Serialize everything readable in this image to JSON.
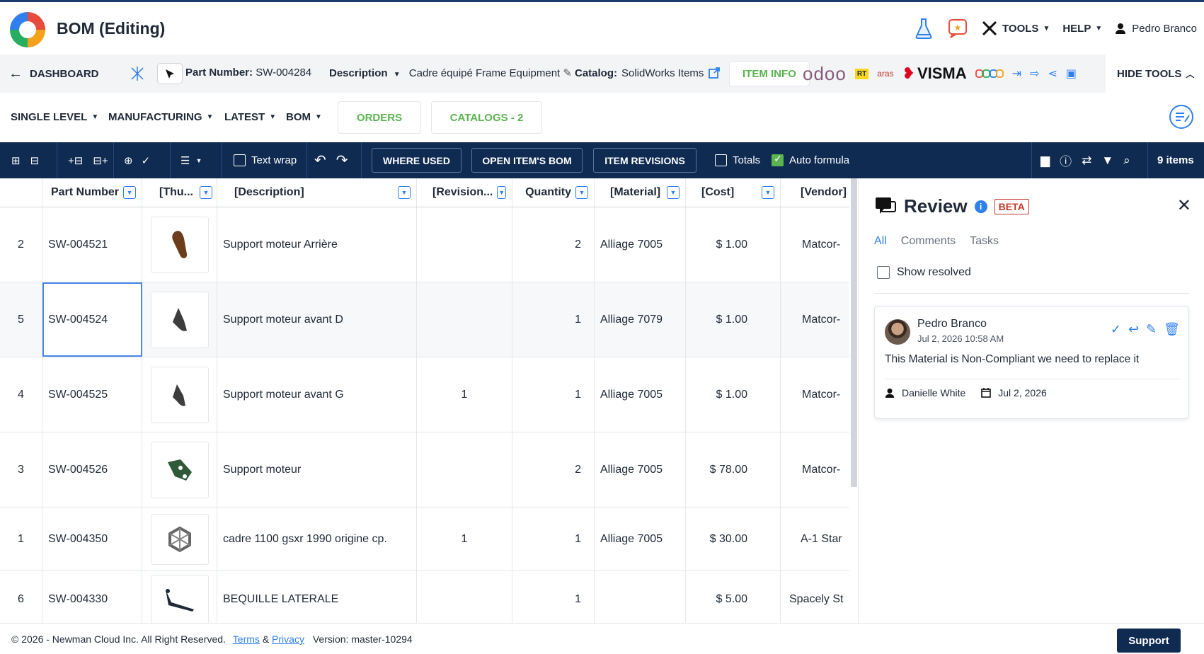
{
  "header": {
    "title": "BOM (Editing)",
    "tools_label": "TOOLS",
    "help_label": "HELP",
    "user_name": "Pedro Branco"
  },
  "partbar": {
    "dashboard_label": "DASHBOARD",
    "part_number_label": "Part Number:",
    "part_number": "SW-004284",
    "description_label": "Description",
    "description_value": "Cadre équipé Frame Equipment",
    "catalog_label": "Catalog:",
    "catalog_value": "SolidWorks Items",
    "item_info_label": "ITEM INFO",
    "brand_odoo": "odoo",
    "brand_rt": "RT",
    "brand_aras": "aras",
    "brand_visma": "VISMA",
    "hide_tools_label": "HIDE TOOLS"
  },
  "filters": {
    "level": "SINGLE LEVEL",
    "type": "MANUFACTURING",
    "revision": "LATEST",
    "view": "BOM",
    "orders_label": "ORDERS",
    "catalogs_label": "CATALOGS - 2"
  },
  "toolbar": {
    "text_wrap_label": "Text wrap",
    "where_used_label": "WHERE USED",
    "open_bom_label": "OPEN ITEM'S BOM",
    "item_revisions_label": "ITEM REVISIONS",
    "totals_label": "Totals",
    "auto_formula_label": "Auto formula",
    "items_count": "9 items"
  },
  "grid": {
    "columns": [
      "Part Number",
      "[Thu...",
      "[Description]",
      "[Revision...",
      "Quantity",
      "[Material]",
      "[Cost]",
      "[Vendor]"
    ],
    "rows": [
      {
        "idx": "2",
        "part": "SW-004521",
        "desc": "Support moteur Arrière",
        "rev": "",
        "qty": "2",
        "material": "Alliage 7005",
        "cost": "$ 1.00",
        "vendor": "Matcor-"
      },
      {
        "idx": "5",
        "part": "SW-004524",
        "desc": "Support moteur avant D",
        "rev": "",
        "qty": "1",
        "material": "Alliage 7079",
        "cost": "$ 1.00",
        "vendor": "Matcor-"
      },
      {
        "idx": "4",
        "part": "SW-004525",
        "desc": "Support moteur avant G",
        "rev": "1",
        "qty": "1",
        "material": "Alliage 7005",
        "cost": "$ 1.00",
        "vendor": "Matcor-"
      },
      {
        "idx": "3",
        "part": "SW-004526",
        "desc": "Support moteur",
        "rev": "",
        "qty": "2",
        "material": "Alliage 7005",
        "cost": "$ 78.00",
        "vendor": "Matcor-"
      },
      {
        "idx": "1",
        "part": "SW-004350",
        "desc": "cadre 1100 gsxr 1990 origine cp.",
        "rev": "1",
        "qty": "1",
        "material": "Alliage 7005",
        "cost": "$ 30.00",
        "vendor": "A-1 Star"
      },
      {
        "idx": "6",
        "part": "SW-004330",
        "desc": "BEQUILLE LATERALE",
        "rev": "",
        "qty": "1",
        "material": "",
        "cost": "$ 5.00",
        "vendor": "Spacely St"
      }
    ]
  },
  "review": {
    "title": "Review",
    "beta_label": "BETA",
    "tabs": [
      "All",
      "Comments",
      "Tasks"
    ],
    "show_resolved_label": "Show resolved",
    "comment": {
      "author": "Pedro Branco",
      "date": "Jul 2, 2026 10:58 AM",
      "text": "This Material is Non-Compliant we need to replace it",
      "assignee": "Danielle White",
      "due_date": "Jul 2, 2026"
    }
  },
  "footer": {
    "copyright": "© 2026 - Newman Cloud Inc. All Right Reserved.",
    "terms_label": "Terms",
    "and": "&",
    "privacy_label": "Privacy",
    "version": "Version: master-10294",
    "support_label": "Support"
  }
}
